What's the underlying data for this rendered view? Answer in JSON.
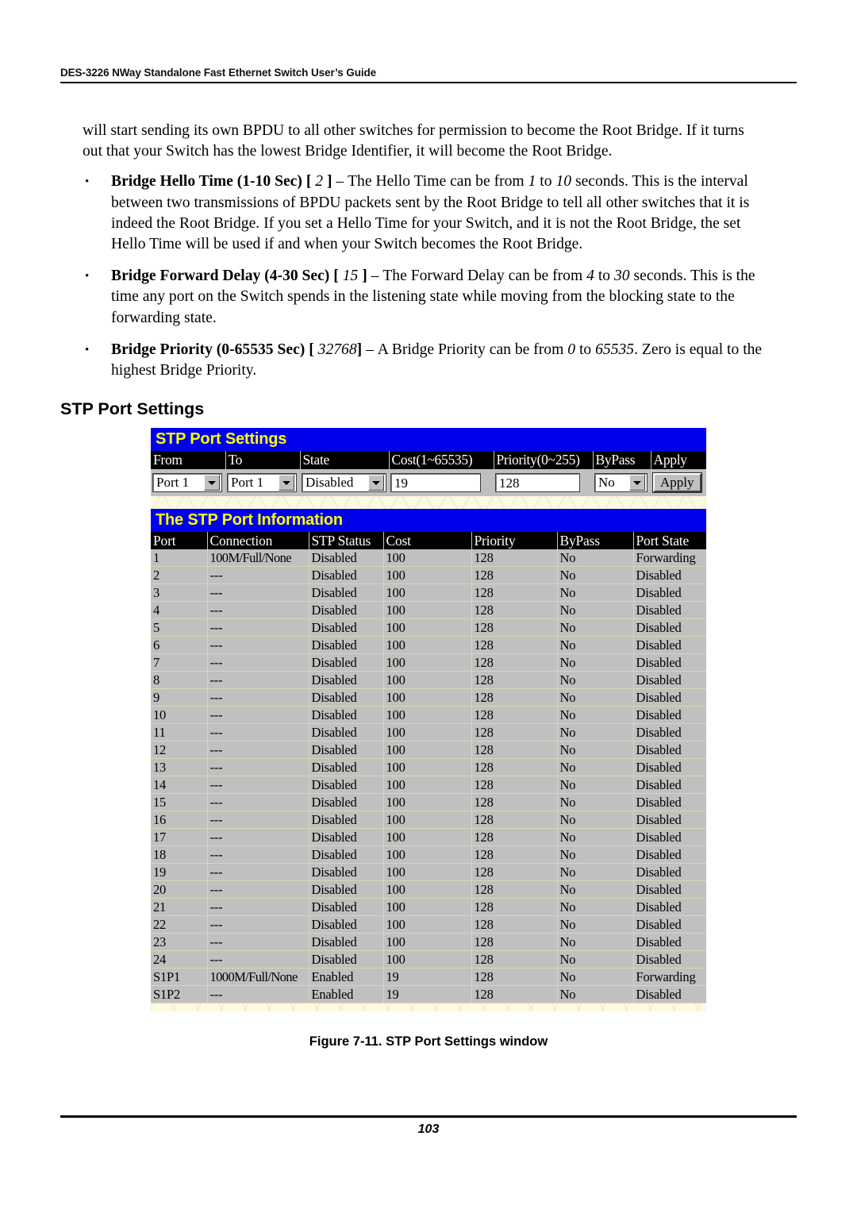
{
  "document": {
    "header": "DES-3226 NWay Standalone Fast Ethernet Switch User’s Guide",
    "page_number": "103",
    "figure_caption": "Figure 7-11.  STP Port Settings window",
    "section_title": "STP Port Settings"
  },
  "body": {
    "intro_paragraph": "will start sending its own BPDU to all other switches for permission to become the Root Bridge. If it turns out that your Switch has the lowest Bridge Identifier, it will become the Root Bridge.",
    "bullets": [
      {
        "term": "Bridge Hello Time (1-10 Sec)",
        "bracket_open": "[",
        "default_value": "2",
        "bracket_close": "]",
        "dash": "–",
        "text_a": "The Hello Time can be from",
        "value_min": "1",
        "to": "to",
        "value_max": "10",
        "text_b": "seconds. This is the interval between two transmissions of BPDU packets sent by the Root Bridge to tell all other switches that it is indeed the Root Bridge. If you set a Hello Time for your Switch, and it is not the Root Bridge, the set Hello Time will be used if and when your Switch becomes the Root Bridge."
      },
      {
        "term": "Bridge Forward Delay (4-30 Sec)",
        "bracket_open": "[",
        "default_value": "15",
        "bracket_close": "]",
        "dash": "–",
        "text_a": "The Forward Delay can be from",
        "value_min": "4",
        "to": "to",
        "value_max": "30",
        "text_b": "seconds. This is the time any port on the Switch spends in the listening state while moving from the blocking state to the forwarding state."
      },
      {
        "term": "Bridge Priority (0-65535 Sec)",
        "bracket_open": "[",
        "default_value": "32768",
        "bracket_close": "]",
        "dash": "–",
        "text_a": "A Bridge Priority can be from",
        "value_min": "0",
        "to": "to",
        "value_max": "65535",
        "text_b": ". Zero is equal to the highest Bridge Priority."
      }
    ]
  },
  "screenshot": {
    "settings_panel": {
      "title": "STP Port Settings",
      "columns": [
        "From",
        "To",
        "State",
        "Cost(1~65535)",
        "Priority(0~255)",
        "ByPass",
        "Apply"
      ],
      "fields": {
        "from_value": "Port 1",
        "to_value": "Port 1",
        "state_value": "Disabled",
        "cost_value": "19",
        "priority_value": "128",
        "bypass_value": "No",
        "apply_label": "Apply"
      }
    },
    "info_panel": {
      "title": "The STP Port Information",
      "columns": [
        "Port",
        "Connection",
        "STP Status",
        "Cost",
        "Priority",
        "ByPass",
        "Port State"
      ],
      "rows": [
        [
          "1",
          "100M/Full/None",
          "Disabled",
          "100",
          "128",
          "No",
          "Forwarding"
        ],
        [
          "2",
          "---",
          "Disabled",
          "100",
          "128",
          "No",
          "Disabled"
        ],
        [
          "3",
          "---",
          "Disabled",
          "100",
          "128",
          "No",
          "Disabled"
        ],
        [
          "4",
          "---",
          "Disabled",
          "100",
          "128",
          "No",
          "Disabled"
        ],
        [
          "5",
          "---",
          "Disabled",
          "100",
          "128",
          "No",
          "Disabled"
        ],
        [
          "6",
          "---",
          "Disabled",
          "100",
          "128",
          "No",
          "Disabled"
        ],
        [
          "7",
          "---",
          "Disabled",
          "100",
          "128",
          "No",
          "Disabled"
        ],
        [
          "8",
          "---",
          "Disabled",
          "100",
          "128",
          "No",
          "Disabled"
        ],
        [
          "9",
          "---",
          "Disabled",
          "100",
          "128",
          "No",
          "Disabled"
        ],
        [
          "10",
          "---",
          "Disabled",
          "100",
          "128",
          "No",
          "Disabled"
        ],
        [
          "11",
          "---",
          "Disabled",
          "100",
          "128",
          "No",
          "Disabled"
        ],
        [
          "12",
          "---",
          "Disabled",
          "100",
          "128",
          "No",
          "Disabled"
        ],
        [
          "13",
          "---",
          "Disabled",
          "100",
          "128",
          "No",
          "Disabled"
        ],
        [
          "14",
          "---",
          "Disabled",
          "100",
          "128",
          "No",
          "Disabled"
        ],
        [
          "15",
          "---",
          "Disabled",
          "100",
          "128",
          "No",
          "Disabled"
        ],
        [
          "16",
          "---",
          "Disabled",
          "100",
          "128",
          "No",
          "Disabled"
        ],
        [
          "17",
          "---",
          "Disabled",
          "100",
          "128",
          "No",
          "Disabled"
        ],
        [
          "18",
          "---",
          "Disabled",
          "100",
          "128",
          "No",
          "Disabled"
        ],
        [
          "19",
          "---",
          "Disabled",
          "100",
          "128",
          "No",
          "Disabled"
        ],
        [
          "20",
          "---",
          "Disabled",
          "100",
          "128",
          "No",
          "Disabled"
        ],
        [
          "21",
          "---",
          "Disabled",
          "100",
          "128",
          "No",
          "Disabled"
        ],
        [
          "22",
          "---",
          "Disabled",
          "100",
          "128",
          "No",
          "Disabled"
        ],
        [
          "23",
          "---",
          "Disabled",
          "100",
          "128",
          "No",
          "Disabled"
        ],
        [
          "24",
          "---",
          "Disabled",
          "100",
          "128",
          "No",
          "Disabled"
        ],
        [
          "S1P1",
          "1000M/Full/None",
          "Enabled",
          "19",
          "128",
          "No",
          "Forwarding"
        ],
        [
          "S1P2",
          "---",
          "Enabled",
          "19",
          "128",
          "No",
          "Disabled"
        ]
      ]
    }
  },
  "colors": {
    "title_bar_bg": "#0000f0",
    "title_bar_fg": "#ffff00",
    "table_header_bg": "#000000",
    "table_header_fg": "#ffffff",
    "cell_bg": "#c0c0c0",
    "page_bg": "#fdfae1"
  }
}
